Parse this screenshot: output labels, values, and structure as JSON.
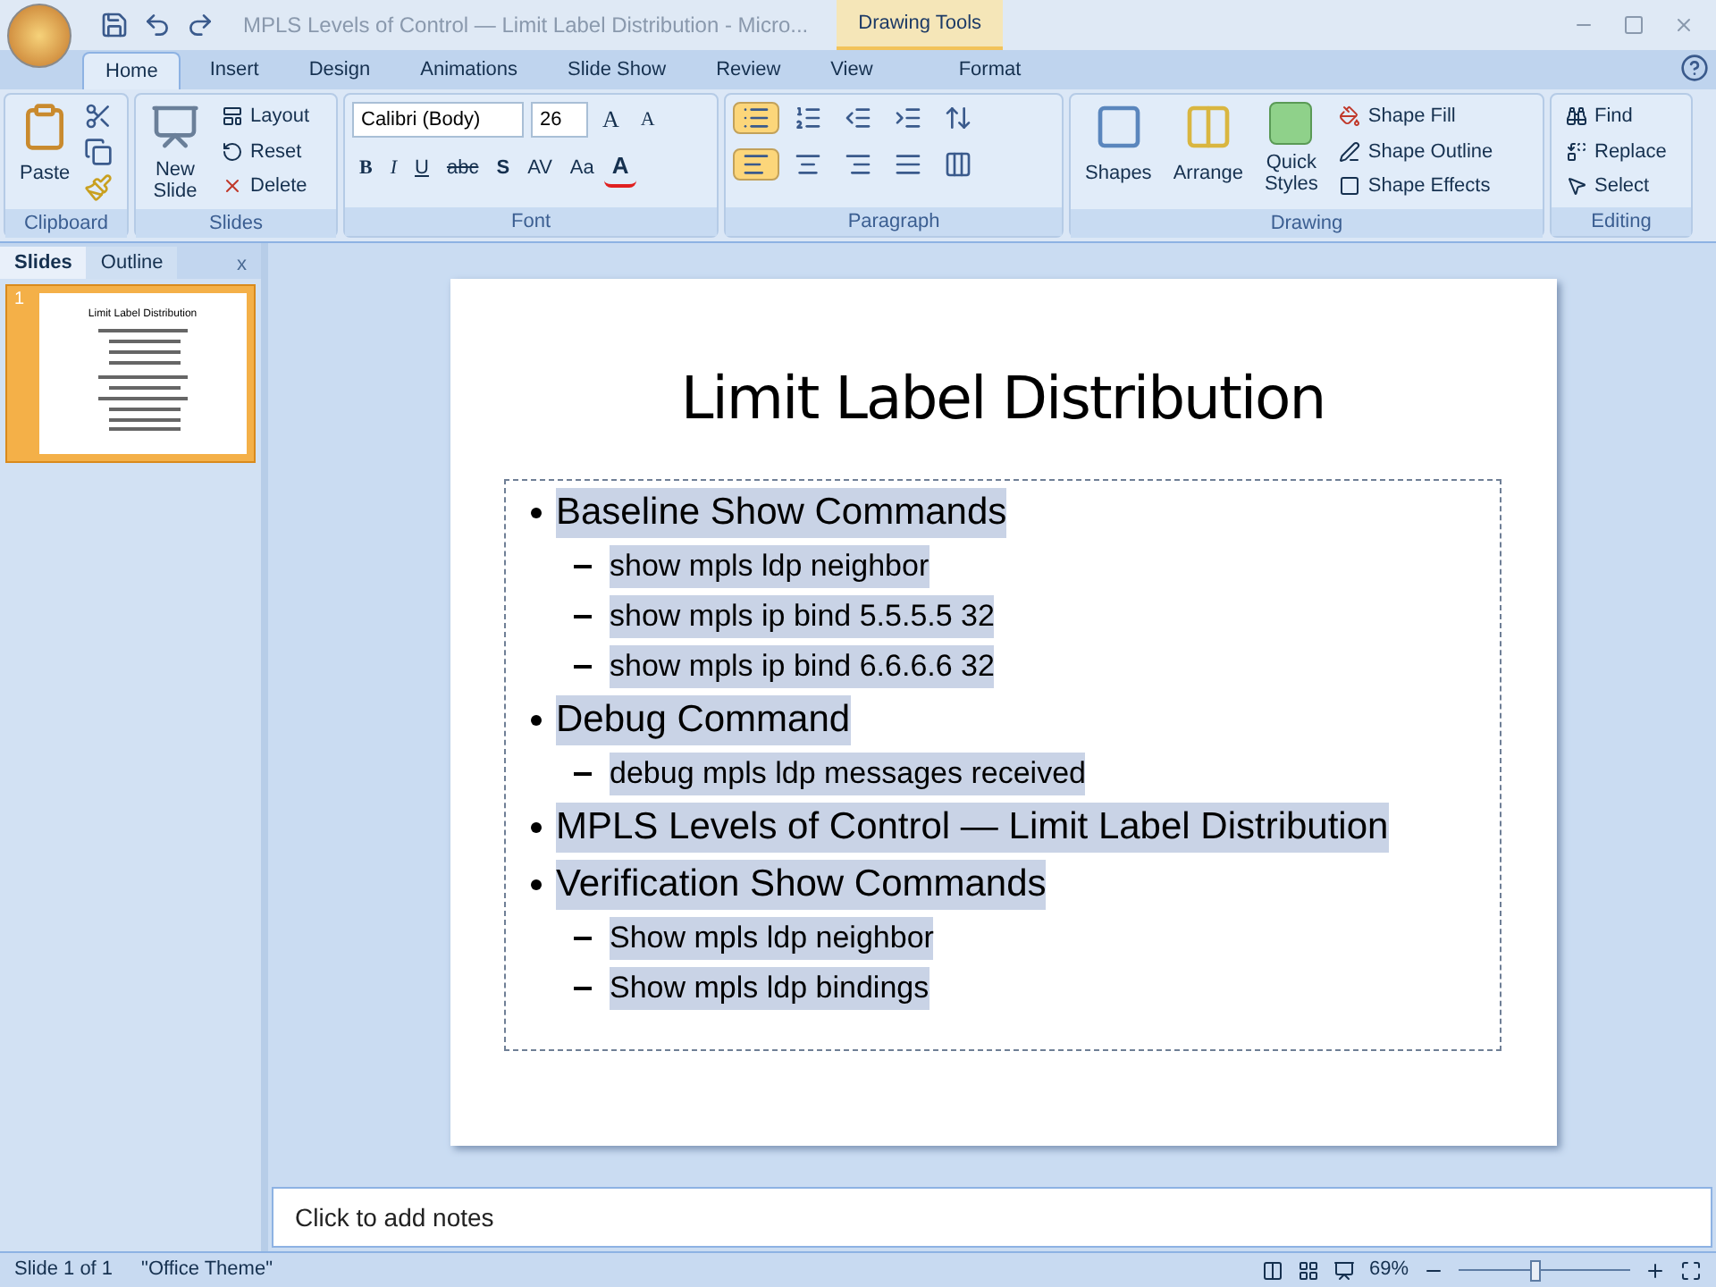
{
  "window": {
    "title": "MPLS Levels of Control — Limit Label Distribution - Micro...",
    "context_tab_group": "Drawing Tools"
  },
  "tabs": [
    {
      "label": "Home",
      "selected": true
    },
    {
      "label": "Insert",
      "selected": false
    },
    {
      "label": "Design",
      "selected": false
    },
    {
      "label": "Animations",
      "selected": false
    },
    {
      "label": "Slide Show",
      "selected": false
    },
    {
      "label": "Review",
      "selected": false
    },
    {
      "label": "View",
      "selected": false
    },
    {
      "label": "Format",
      "selected": false
    }
  ],
  "ribbon": {
    "clipboard": {
      "label": "Clipboard",
      "paste": "Paste"
    },
    "slides": {
      "label": "Slides",
      "new_slide": [
        "New",
        "Slide"
      ],
      "layout": "Layout",
      "reset": "Reset",
      "delete": "Delete"
    },
    "font": {
      "label": "Font",
      "family": "Calibri (Body)",
      "size": "26",
      "grow": "A",
      "shrink": "A",
      "bold": "B",
      "italic": "I",
      "underline": "U",
      "strike": "abc",
      "shadow": "S",
      "spacing": "AV",
      "case": "Aa",
      "color_letter": "A"
    },
    "paragraph": {
      "label": "Paragraph",
      "bullets_on": true,
      "align_left_on": true
    },
    "drawing": {
      "label": "Drawing",
      "shapes": "Shapes",
      "arrange": "Arrange",
      "quick_styles": [
        "Quick",
        "Styles"
      ],
      "shape_fill": "Shape Fill",
      "shape_outline": "Shape Outline",
      "shape_effects": "Shape Effects"
    },
    "editing": {
      "label": "Editing",
      "find": "Find",
      "replace": "Replace",
      "select": "Select"
    }
  },
  "pane": {
    "tabs": [
      {
        "label": "Slides",
        "selected": true
      },
      {
        "label": "Outline",
        "selected": false
      }
    ],
    "close": "x",
    "thumbnails": [
      {
        "number": "1",
        "selected": true,
        "title": "Limit Label Distribution"
      }
    ]
  },
  "slide": {
    "title": "Limit Label Distribution",
    "text_highlighted": true,
    "bullets": [
      {
        "text": "Baseline Show Commands",
        "children": [
          {
            "text": "show mpls ldp neighbor"
          },
          {
            "text": "show mpls ip bind 5.5.5.5 32"
          },
          {
            "text": "show mpls ip bind 6.6.6.6 32"
          }
        ]
      },
      {
        "text": "Debug Command",
        "children": [
          {
            "text": "debug mpls ldp messages received"
          }
        ]
      },
      {
        "text": "MPLS Levels of Control — Limit Label Distribution"
      },
      {
        "text": "Verification Show Commands",
        "children": [
          {
            "text": "Show mpls ldp neighbor"
          },
          {
            "text": "Show mpls ldp bindings"
          }
        ]
      }
    ]
  },
  "notes": {
    "placeholder": "Click to add notes"
  },
  "status_bar": {
    "slide": "Slide 1 of 1",
    "theme": "\"Office Theme\"",
    "zoom": "69%",
    "zoom_slider": {
      "level": 0.45
    }
  }
}
